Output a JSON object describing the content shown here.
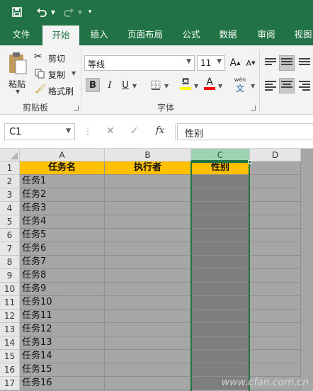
{
  "quick_access": {
    "save_icon": "save-icon",
    "undo_icon": "undo-icon",
    "redo_icon": "redo-icon",
    "customize_icon": "customize-icon"
  },
  "tabs": [
    {
      "label": "文件"
    },
    {
      "label": "开始"
    },
    {
      "label": "插入"
    },
    {
      "label": "页面布局"
    },
    {
      "label": "公式"
    },
    {
      "label": "数据"
    },
    {
      "label": "审阅"
    },
    {
      "label": "视图"
    }
  ],
  "active_tab": "开始",
  "clipboard": {
    "paste": "粘贴",
    "cut": "剪切",
    "copy": "复制",
    "format_painter": "格式刷",
    "group_label": "剪贴板"
  },
  "font": {
    "name": "等线",
    "size": "11",
    "bold": "B",
    "italic": "I",
    "underline": "U",
    "group_label": "字体",
    "phonetic_top": "wén",
    "phonetic_bottom": "文",
    "font_color_letter": "A"
  },
  "formula_bar": {
    "name_box": "C1",
    "fx": "fx",
    "cancel": "✕",
    "enter": "✓",
    "content": "性别"
  },
  "columns": [
    "A",
    "B",
    "C",
    "D"
  ],
  "selected_column": "C",
  "rows": [
    "1",
    "2",
    "3",
    "4",
    "5",
    "6",
    "7",
    "8",
    "9",
    "10",
    "11",
    "12",
    "13",
    "14",
    "15",
    "16",
    "17"
  ],
  "header_row": {
    "A": "任务名",
    "B": "执行者",
    "C": "性别"
  },
  "tasks": [
    "任务1",
    "任务2",
    "任务3",
    "任务4",
    "任务5",
    "任务6",
    "任务7",
    "任务8",
    "任务9",
    "任务10",
    "任务11",
    "任务12",
    "任务13",
    "任务14",
    "任务15",
    "任务16"
  ],
  "colors": {
    "accent": "#217346",
    "header_fill": "#ffc000",
    "grid_fill": "#a6a6a6",
    "selected_col_fill": "#7e7e7e"
  },
  "watermark": "www.cfan.com.cn"
}
